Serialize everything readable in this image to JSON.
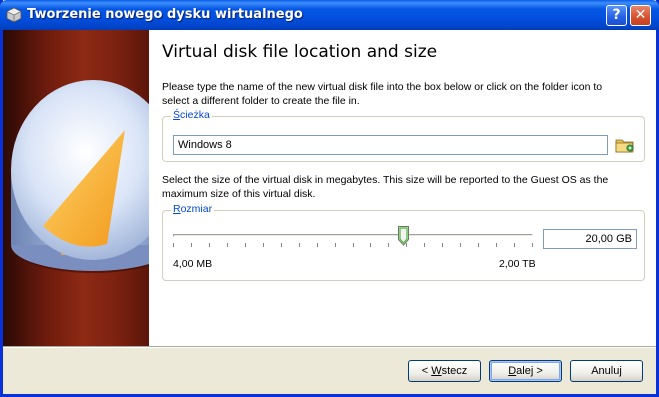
{
  "window": {
    "title": "Tworzenie nowego dysku wirtualnego",
    "help_label": "?",
    "close_label": "✕"
  },
  "page": {
    "heading": "Virtual disk file location and size",
    "location_description": "Please type the name of the new virtual disk file into the box below or click on the folder icon to select a different folder to create the file in.",
    "size_description": "Select the size of the virtual disk in megabytes. This size will be reported to the Guest OS as the maximum size of this virtual disk."
  },
  "location_group": {
    "label_mnemonic": "Ś",
    "label_rest": "cieżka",
    "value": "Windows 8",
    "folder_icon": "folder-browse-icon"
  },
  "size_group": {
    "label_mnemonic": "R",
    "label_rest": "ozmiar",
    "slider_fraction": 0.64,
    "min_label": "4,00 MB",
    "max_label": "2,00 TB",
    "value": "20,00 GB"
  },
  "buttons": {
    "back_mnemonic": "W",
    "back_prefix": "< ",
    "back_rest": "stecz",
    "next_mnemonic": "D",
    "next_rest": "alej >",
    "cancel": "Anuluj"
  },
  "colors": {
    "titlebar": "#0250df",
    "accent_label": "#0046d5",
    "panel": "#8d2a14",
    "disk_slice": "#f7b23a"
  }
}
